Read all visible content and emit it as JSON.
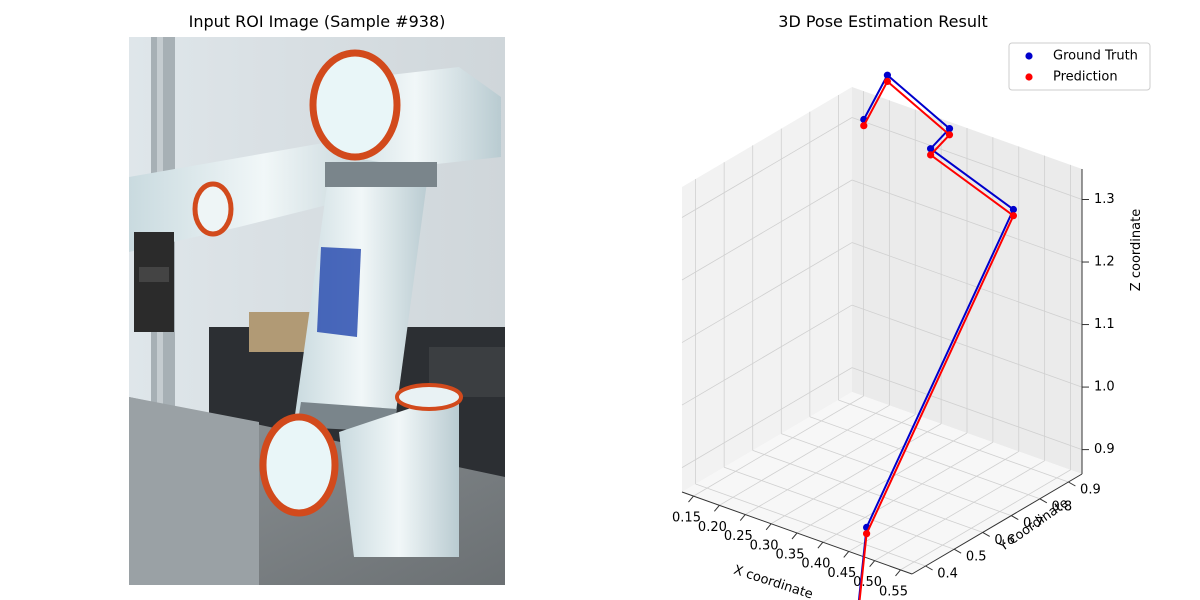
{
  "left_panel": {
    "title": "Input ROI Image (Sample #938)"
  },
  "right_panel": {
    "title": "3D Pose Estimation Result"
  },
  "chart_data": {
    "type": "scatter",
    "projection": "3d",
    "title": "3D Pose Estimation Result",
    "xlabel": "X coordinate",
    "ylabel": "Y coordinate",
    "zlabel": "Z coordinate",
    "xticks": [
      "0.15",
      "0.20",
      "0.25",
      "0.30",
      "0.35",
      "0.40",
      "0.45",
      "0.50",
      "0.55"
    ],
    "yticks": [
      "0.4",
      "0.5",
      "0.6",
      "0.7",
      "0.8",
      "0.9"
    ],
    "zticks": [
      "0.9",
      "1.0",
      "1.1",
      "1.2",
      "1.3"
    ],
    "grid": true,
    "legend_position": "top-right",
    "colors": {
      "ground_truth": "#0000cc",
      "prediction": "#ff0000"
    },
    "series": [
      {
        "name": "Ground Truth",
        "color": "#0000cc",
        "points": [
          {
            "x": 0.43,
            "y": 0.42,
            "z": 0.74
          },
          {
            "x": 0.37,
            "y": 0.56,
            "z": 0.82
          },
          {
            "x": 0.51,
            "y": 0.82,
            "z": 1.3
          },
          {
            "x": 0.35,
            "y": 0.82,
            "z": 1.35
          },
          {
            "x": 0.37,
            "y": 0.85,
            "z": 1.38
          },
          {
            "x": 0.25,
            "y": 0.85,
            "z": 1.43
          },
          {
            "x": 0.21,
            "y": 0.84,
            "z": 1.35
          }
        ]
      },
      {
        "name": "Prediction",
        "color": "#ff0000",
        "points": [
          {
            "x": 0.43,
            "y": 0.42,
            "z": 0.73
          },
          {
            "x": 0.37,
            "y": 0.56,
            "z": 0.81
          },
          {
            "x": 0.51,
            "y": 0.82,
            "z": 1.29
          },
          {
            "x": 0.35,
            "y": 0.82,
            "z": 1.34
          },
          {
            "x": 0.37,
            "y": 0.85,
            "z": 1.37
          },
          {
            "x": 0.25,
            "y": 0.85,
            "z": 1.42
          },
          {
            "x": 0.21,
            "y": 0.84,
            "z": 1.34
          }
        ]
      }
    ]
  }
}
